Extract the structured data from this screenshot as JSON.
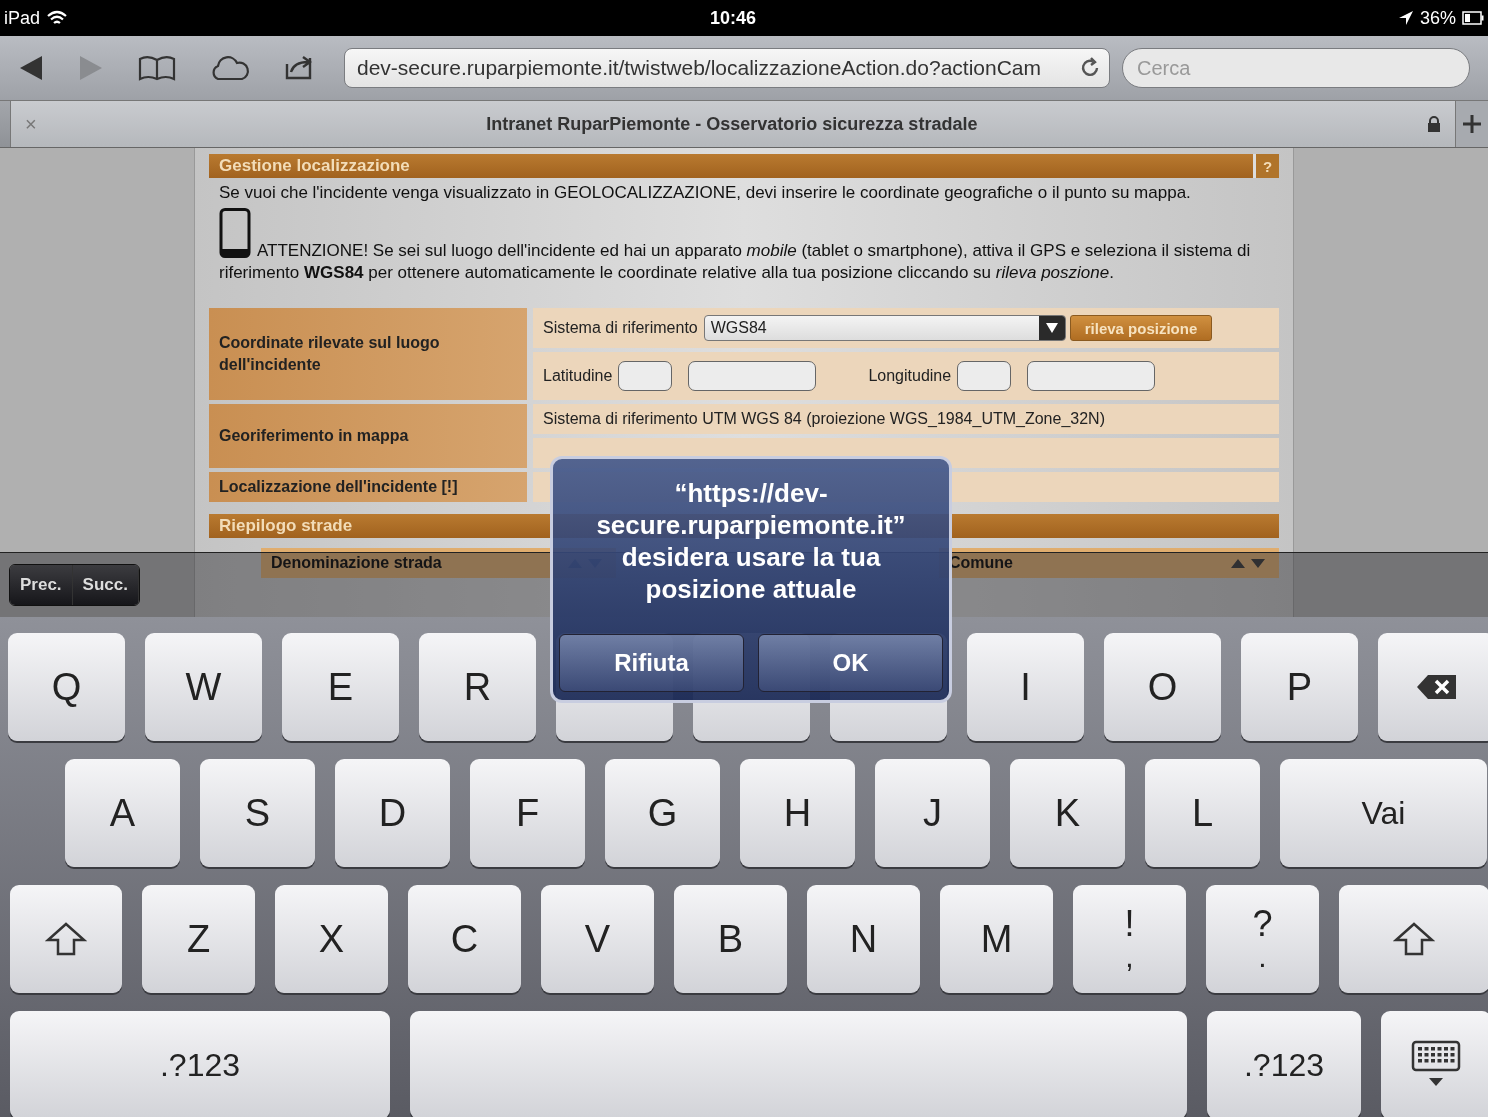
{
  "status_bar": {
    "carrier": "iPad",
    "time": "10:46",
    "battery": "36%"
  },
  "toolbar": {
    "url": "dev-secure.ruparpiemonte.it/twistweb/localizzazioneAction.do?actionCam",
    "search": {
      "placeholder": "Cerca"
    }
  },
  "tab": {
    "close": "×",
    "title": "Intranet RuparPiemonte - Osservatorio sicurezza stradale"
  },
  "panel": {
    "title": "Gestione localizzazione",
    "help": "?",
    "intro": "Se vuoi che l'incidente venga visualizzato in GEOLOCALIZZAZIONE, devi inserire le coordinate geografiche o il punto su mappa.",
    "warning": "ATTENZIONE! Se sei sul luogo dell'incidente ed hai un apparato *mobile* (tablet o smartphone), attiva il GPS e seleziona il sistema di riferimento **WGS84** per ottenere automaticamente le coordinate relative alla tua posizione cliccando su *rileva poszione*.",
    "rows": [
      {
        "label": "Coordinate rilevate sul luogo dell'incidente",
        "lines": [
          {
            "kind": "select",
            "label": "Sistema di riferimento",
            "value": "WGS84",
            "button": "rileva posizione"
          },
          {
            "kind": "coords",
            "fields": [
              {
                "label": "Latitudine"
              },
              {
                "label": "Longitudine"
              }
            ]
          }
        ]
      },
      {
        "label": "Georiferimento in mappa",
        "lines": [
          {
            "kind": "text",
            "text": "Sistema di riferimento UTM WGS 84 (proiezione WGS_1984_UTM_Zone_32N)"
          },
          {
            "kind": "blank"
          }
        ]
      },
      {
        "label": "Localizzazione dell'incidente [!]",
        "lines": [
          {
            "kind": "blank"
          }
        ]
      }
    ]
  },
  "summary": {
    "title": "Riepilogo strade",
    "columns": [
      {
        "label": "Denominazione strada"
      },
      {
        "label": "Comune"
      }
    ]
  },
  "accessory": {
    "prev": "Prec.",
    "next": "Succ."
  },
  "alert": {
    "message": "“https://dev-secure.ruparpiemonte.it” desidera usare la tua posizione attuale",
    "buttons": [
      {
        "label": "Rifiuta"
      },
      {
        "label": "OK"
      }
    ]
  },
  "keyboard": [
    [
      {
        "kind": "letter",
        "label": "Q"
      },
      {
        "kind": "letter",
        "label": "W"
      },
      {
        "kind": "letter",
        "label": "E"
      },
      {
        "kind": "letter",
        "label": "R"
      },
      {
        "kind": "covered"
      },
      {
        "kind": "covered"
      },
      {
        "kind": "covered"
      },
      {
        "kind": "letter",
        "label": "I"
      },
      {
        "kind": "letter",
        "label": "O"
      },
      {
        "kind": "letter",
        "label": "P"
      },
      {
        "kind": "backspace"
      }
    ],
    [
      {
        "kind": "letter",
        "label": "A"
      },
      {
        "kind": "letter",
        "label": "S"
      },
      {
        "kind": "letter",
        "label": "D"
      },
      {
        "kind": "letter",
        "label": "F"
      },
      {
        "kind": "letter",
        "label": "G"
      },
      {
        "kind": "letter",
        "label": "H"
      },
      {
        "kind": "letter",
        "label": "J"
      },
      {
        "kind": "letter",
        "label": "K"
      },
      {
        "kind": "letter",
        "label": "L"
      },
      {
        "kind": "return",
        "label": "Vai"
      }
    ],
    [
      {
        "kind": "shift"
      },
      {
        "kind": "letter",
        "label": "Z"
      },
      {
        "kind": "letter",
        "label": "X"
      },
      {
        "kind": "letter",
        "label": "C"
      },
      {
        "kind": "letter",
        "label": "V"
      },
      {
        "kind": "letter",
        "label": "B"
      },
      {
        "kind": "letter",
        "label": "N"
      },
      {
        "kind": "letter",
        "label": "M"
      },
      {
        "kind": "dual",
        "label": "!",
        "sub": ","
      },
      {
        "kind": "dual",
        "label": "?",
        "sub": "."
      },
      {
        "kind": "shift"
      }
    ],
    [
      {
        "kind": "mode",
        "label": ".?123"
      },
      {
        "kind": "space"
      },
      {
        "kind": "mode",
        "label": ".?123"
      },
      {
        "kind": "hide"
      }
    ]
  ]
}
